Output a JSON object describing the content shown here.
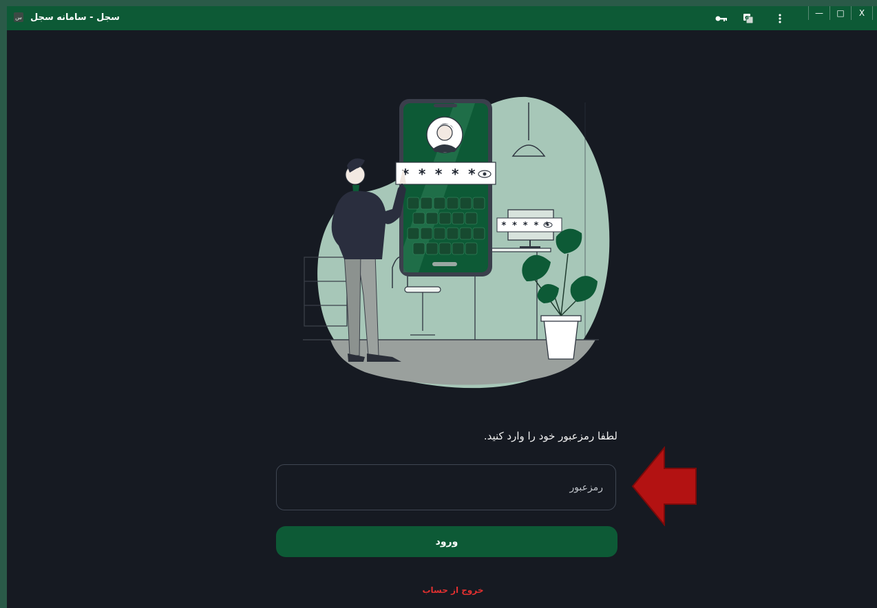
{
  "window": {
    "title": "سجل - سامانه سجل",
    "app_icon_glyph": "س"
  },
  "titlebar_icons": [
    "key-icon",
    "translate-icon",
    "more-vertical-icon"
  ],
  "window_controls": {
    "minimize": "—",
    "maximize": "□",
    "close": "X"
  },
  "illustration": {
    "phone_password_mask": "* * * * *",
    "monitor_password_mask": "* * * * *"
  },
  "login": {
    "prompt": "لطفا رمزعبور خود را وارد کنید.",
    "password_placeholder": "رمزعبور",
    "submit_label": "ورود",
    "logout_label": "خروج از حساب"
  },
  "colors": {
    "brand_green": "#0d5a36",
    "background": "#161a22",
    "logout_red": "#e03030",
    "annotation_arrow": "#b31212"
  }
}
